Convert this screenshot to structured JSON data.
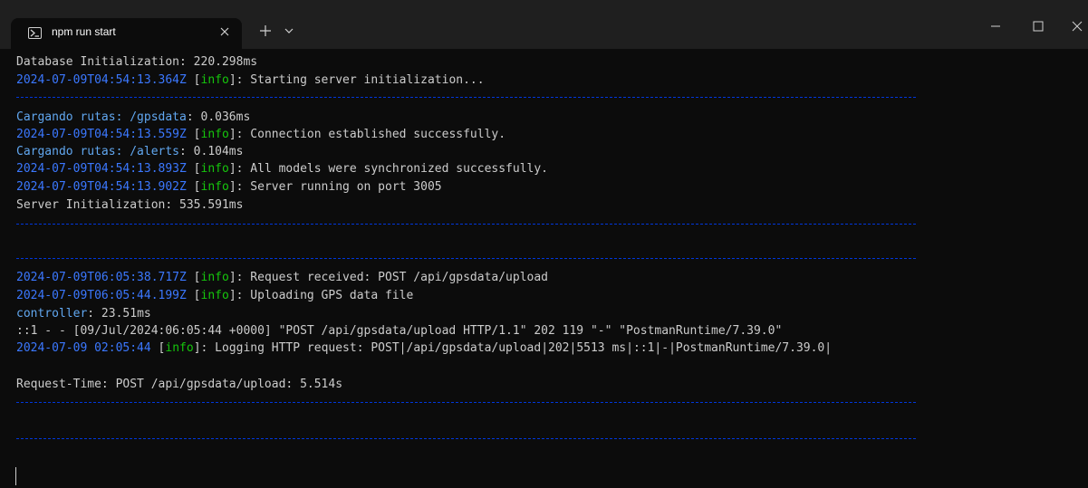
{
  "tab": {
    "icon": "powershell-icon",
    "title": "npm run start",
    "close_icon": "close-icon"
  },
  "titlebar": {
    "new_tab_icon": "plus-icon",
    "dropdown_icon": "chevron-down-icon",
    "controls": [
      "minimize-icon",
      "maximize-icon",
      "close-icon"
    ]
  },
  "colors": {
    "background": "#0c0c0c",
    "titlebar": "#1f1f1f",
    "text": "#cccccc",
    "timestamp": "#3b78ff",
    "info_tag": "#16c60c",
    "label": "#61a7f0",
    "separator": "#0037da"
  },
  "terminal": {
    "db_init": "Database Initialization: 220.298ms",
    "log1": {
      "ts": "2024-07-09T04:54:13.364Z",
      "tag": "info",
      "msg": ": Starting server initialization..."
    },
    "route_gps": {
      "label": "Cargando rutas: /gpsdata",
      "value": ": 0.036ms"
    },
    "log2": {
      "ts": "2024-07-09T04:54:13.559Z",
      "tag": "info",
      "msg": ": Connection established successfully."
    },
    "route_alerts": {
      "label": "Cargando rutas: /alerts",
      "value": ": 0.104ms"
    },
    "log3": {
      "ts": "2024-07-09T04:54:13.893Z",
      "tag": "info",
      "msg": ": All models were synchronized successfully."
    },
    "log4": {
      "ts": "2024-07-09T04:54:13.902Z",
      "tag": "info",
      "msg": ": Server running on port 3005"
    },
    "server_init": "Server Initialization: 535.591ms",
    "log5": {
      "ts": "2024-07-09T06:05:38.717Z",
      "tag": "info",
      "msg": ": Request received: POST /api/gpsdata/upload"
    },
    "log6": {
      "ts": "2024-07-09T06:05:44.199Z",
      "tag": "info",
      "msg": ": Uploading GPS data file"
    },
    "controller": {
      "label": "controller",
      "value": ": 23.51ms"
    },
    "access_log": "::1 - - [09/Jul/2024:06:05:44 +0000] \"POST /api/gpsdata/upload HTTP/1.1\" 202 119 \"-\" \"PostmanRuntime/7.39.0\"",
    "log7": {
      "ts": "2024-07-09 02:05:44",
      "tag": "info",
      "msg": ": Logging HTTP request: POST|/api/gpsdata/upload|202|5513 ms|::1|-|PostmanRuntime/7.39.0|"
    },
    "request_time": "Request-Time: POST /api/gpsdata/upload: 5.514s"
  }
}
